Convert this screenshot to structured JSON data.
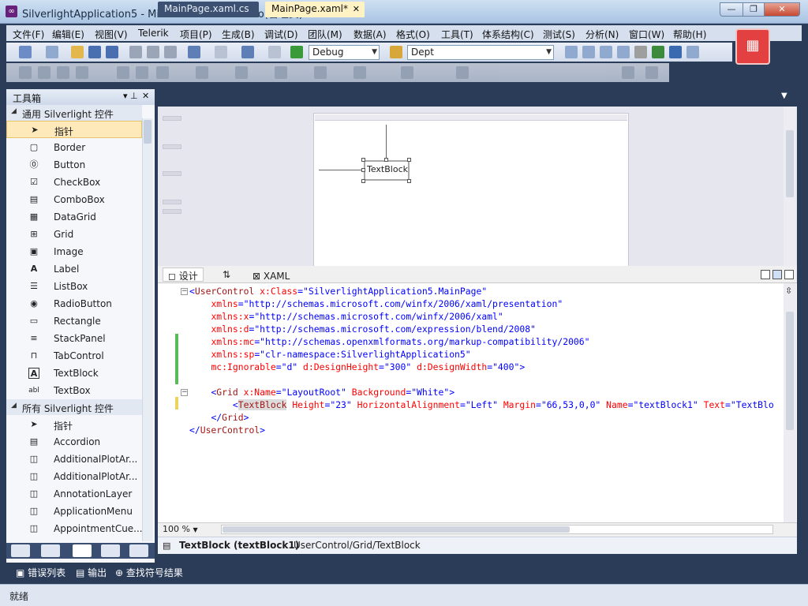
{
  "window": {
    "title": "SilverlightApplication5 - Microsoft Visual Studio(管理员)",
    "minimize": "—",
    "maximize": "❐",
    "close": "✕"
  },
  "menu": [
    "文件(F)",
    "编辑(E)",
    "视图(V)",
    "Telerik",
    "项目(P)",
    "生成(B)",
    "调试(D)",
    "团队(M)",
    "数据(A)",
    "格式(O)",
    "工具(T)",
    "体系结构(C)",
    "测试(S)",
    "分析(N)",
    "窗口(W)",
    "帮助(H)"
  ],
  "toolbar": {
    "config": "Debug",
    "platform": "Dept"
  },
  "toolbox": {
    "title": "工具箱",
    "pin": "▾ ⊥",
    "close": "✕",
    "category1": "通用 Silverlight 控件",
    "common_items": [
      "指针",
      "Border",
      "Button",
      "CheckBox",
      "ComboBox",
      "DataGrid",
      "Grid",
      "Image",
      "Label",
      "ListBox",
      "RadioButton",
      "Rectangle",
      "StackPanel",
      "TabControl",
      "TextBlock",
      "TextBox"
    ],
    "category2": "所有 Silverlight 控件",
    "all_items": [
      "指针",
      "Accordion",
      "AdditionalPlotAr...",
      "AdditionalPlotAr...",
      "AnnotationLayer",
      "ApplicationMenu",
      "AppointmentCue..."
    ]
  },
  "tabs": {
    "cs": "MainPage.xaml.cs",
    "xaml": "MainPage.xaml*",
    "close": "✕"
  },
  "designer": {
    "textblock_label": "TextBlock"
  },
  "split": {
    "design": "设计",
    "swap": "⇅",
    "xaml": "XAML"
  },
  "code": {
    "l1_tag": "UserControl",
    "l1_attr": "x:Class",
    "l1_val": "\"SilverlightApplication5.MainPage\"",
    "l2_attr": "xmlns",
    "l2_val": "\"http://schemas.microsoft.com/winfx/2006/xaml/presentation\"",
    "l3_attr": "xmlns:x",
    "l3_val": "\"http://schemas.microsoft.com/winfx/2006/xaml\"",
    "l4_attr": "xmlns:d",
    "l4_val": "\"http://schemas.microsoft.com/expression/blend/2008\"",
    "l5_attr": "xmlns:mc",
    "l5_val": "\"http://schemas.openxmlformats.org/markup-compatibility/2006\"",
    "l6_attr": "xmlns:sp",
    "l6_val": "\"clr-namespace:SilverlightApplication5\"",
    "l7_attr1": "mc:Ignorable",
    "l7_val1": "\"d\"",
    "l7_attr2": "d:DesignHeight",
    "l7_val2": "\"300\"",
    "l7_attr3": "d:DesignWidth",
    "l7_val3": "\"400\"",
    "l9_tag": "Grid",
    "l9_attr1": "x:Name",
    "l9_val1": "\"LayoutRoot\"",
    "l9_attr2": "Background",
    "l9_val2": "\"White\"",
    "l10_tag": "TextBlock",
    "l10_attr1": "Height",
    "l10_val1": "\"23\"",
    "l10_attr2": "HorizontalAlignment",
    "l10_val2": "\"Left\"",
    "l10_attr3": "Margin",
    "l10_val3": "\"66,53,0,0\"",
    "l10_attr4": "Name",
    "l10_val4": "\"textBlock1\"",
    "l10_attr5": "Text",
    "l10_val5": "\"TextBlo",
    "l11_tag": "Grid",
    "l12_tag": "UserControl"
  },
  "zoom": "100 %",
  "path": {
    "element": "TextBlock (textBlock1)",
    "crumb": "UserControl/Grid/TextBlock"
  },
  "output_tabs": [
    "错误列表",
    "输出",
    "查找符号结果"
  ],
  "status": "就绪",
  "colors": {
    "accent": "#2b3c59",
    "selected_tab": "#fff2c4",
    "selection": "#fde9b9"
  }
}
